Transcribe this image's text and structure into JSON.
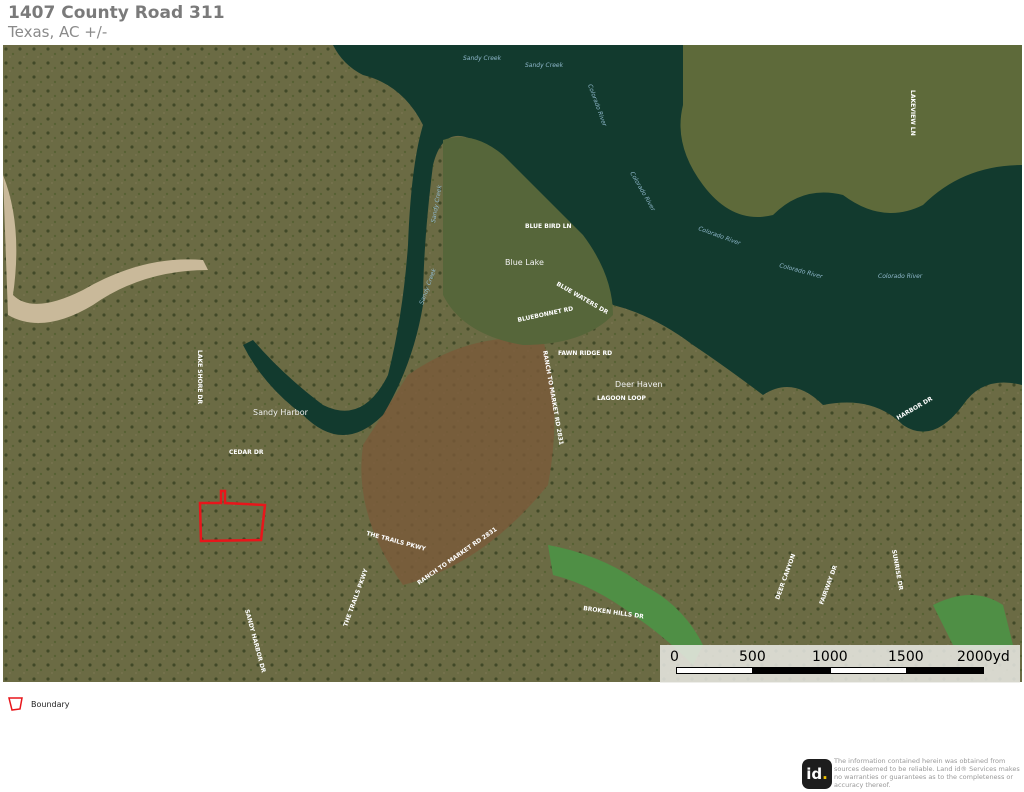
{
  "header": {
    "title": "1407 County Road 311",
    "subtitle": "Texas,  AC +/-"
  },
  "map": {
    "water_labels": [
      "Sandy Creek",
      "Sandy Creek",
      "Colorado River",
      "Colorado River",
      "Colorado River",
      "Colorado River",
      "Colorado River",
      "Sandy Creek",
      "Sandy Creek"
    ],
    "road_labels": [
      "BLUE BIRD LN",
      "BLUE WATERS DR",
      "BLUEBONNET RD",
      "FAWN RIDGE RD",
      "LAGOON LOOP",
      "CEDAR DR",
      "LAKE SHORE DR",
      "THE TRAILS PKWY",
      "THE TRAILS PKWY",
      "SANDY HARBOR DR",
      "RANCH TO MARKET RD 2831",
      "RANCH TO MARKET RD 2831",
      "BROKEN HILLS DR",
      "DEER CANYON",
      "SUNRISE DR",
      "FAIRWAY DR",
      "LAKEVIEW LN",
      "HARBOR DR"
    ],
    "place_labels": [
      "Blue Lake",
      "Deer Haven",
      "Sandy Harbor"
    ],
    "boundary_color": "#e8161b",
    "water_color": "#123a2e"
  },
  "scale_bar": {
    "labels": [
      "0",
      "500",
      "1000",
      "1500",
      "2000yd"
    ]
  },
  "legend": {
    "boundary_label": "Boundary"
  },
  "footer": {
    "disclaimer": "The information contained herein was obtained from sources deemed to be reliable. Land id® Services makes no warranties or guarantees as to the completeness or accuracy thereof.",
    "logo_text": "id"
  }
}
